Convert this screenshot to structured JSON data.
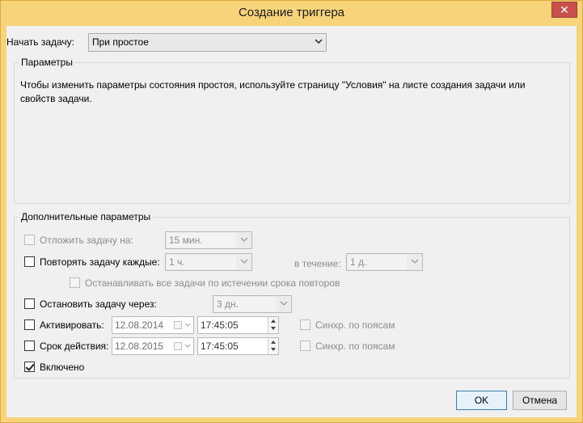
{
  "window": {
    "title": "Создание триггера",
    "close_glyph": "✕"
  },
  "begin_task": {
    "label": "Начать задачу:",
    "value": "При простое"
  },
  "parameters": {
    "title": "Параметры",
    "text_line1": "Чтобы изменить параметры состояния простоя, используйте страницу \"Условия\" на листе создания задачи или",
    "text_line2": "свойств задачи."
  },
  "advanced": {
    "title": "Дополнительные параметры",
    "delay": {
      "label": "Отложить задачу на:",
      "value": "15 мин.",
      "checked": false,
      "enabled": false
    },
    "repeat": {
      "label": "Повторять задачу каждые:",
      "value": "1 ч.",
      "checked": false,
      "enabled": true
    },
    "duration": {
      "label": "в течение:",
      "value": "1 д."
    },
    "stop_all": {
      "label": "Останавливать все задачи по истечении срока повторов",
      "checked": false,
      "enabled": false
    },
    "stop_after": {
      "label": "Остановить задачу через:",
      "value": "3 дн.",
      "checked": false
    },
    "activate": {
      "label": "Активировать:",
      "date": "12.08.2014",
      "time": "17:45:05",
      "sync_label": "Синхр. по поясам",
      "checked": false
    },
    "expire": {
      "label": "Срок действия:",
      "date": "12.08.2015",
      "time": "17:45:05",
      "sync_label": "Синхр. по поясам",
      "checked": false
    },
    "enabled": {
      "label": "Включено",
      "checked": true
    }
  },
  "buttons": {
    "ok": "OK",
    "cancel": "Отмена"
  }
}
